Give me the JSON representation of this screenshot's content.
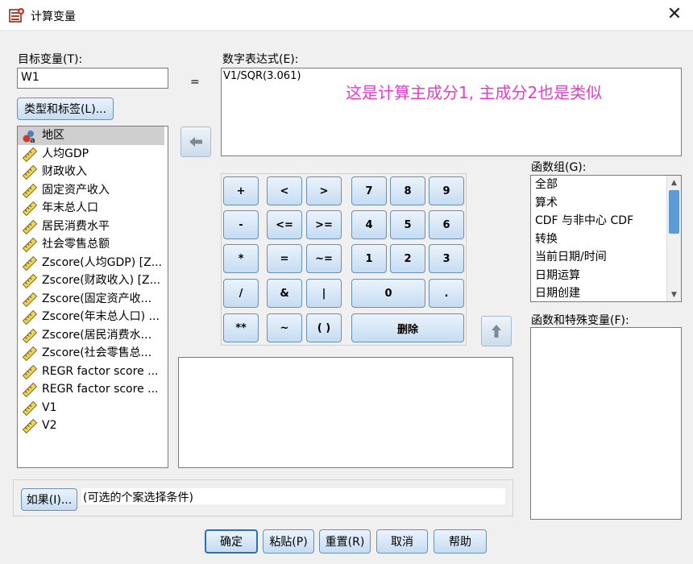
{
  "window": {
    "title": "计算变量",
    "close_glyph": "✕"
  },
  "target": {
    "label": "目标变量(T):",
    "value": "W1",
    "type_button": "类型和标签(L)..."
  },
  "equals": "=",
  "expression": {
    "label": "数字表达式(E):",
    "value": "V1/SQR(3.061)",
    "annotation": "这是计算主成分1, 主成分2也是类似",
    "annotation_color": "#e83ad2"
  },
  "variables": [
    {
      "name": "地区",
      "type": "nominal-string-icon"
    },
    {
      "name": "人均GDP",
      "type": "scale-ruler-icon"
    },
    {
      "name": "财政收入",
      "type": "scale-ruler-icon"
    },
    {
      "name": "固定资产收入",
      "type": "scale-ruler-icon"
    },
    {
      "name": "年末总人口",
      "type": "scale-ruler-icon"
    },
    {
      "name": "居民消费水平",
      "type": "scale-ruler-icon"
    },
    {
      "name": "社会零售总额",
      "type": "scale-ruler-icon"
    },
    {
      "name": "Zscore(人均GDP) [Z...",
      "type": "scale-ruler-icon"
    },
    {
      "name": "Zscore(财政收入) [Z...",
      "type": "scale-ruler-icon"
    },
    {
      "name": "Zscore(固定资产收...",
      "type": "scale-ruler-icon"
    },
    {
      "name": "Zscore(年末总人口) ...",
      "type": "scale-ruler-icon"
    },
    {
      "name": "Zscore(居民消费水...",
      "type": "scale-ruler-icon"
    },
    {
      "name": "Zscore(社会零售总...",
      "type": "scale-ruler-icon"
    },
    {
      "name": "REGR factor score  ...",
      "type": "scale-ruler-icon"
    },
    {
      "name": "REGR factor score  ...",
      "type": "scale-ruler-icon"
    },
    {
      "name": "V1",
      "type": "scale-ruler-icon"
    },
    {
      "name": "V2",
      "type": "scale-ruler-icon"
    }
  ],
  "keypad": {
    "ops": [
      [
        "+",
        "<",
        ">"
      ],
      [
        "-",
        "<=",
        ">="
      ],
      [
        "*",
        "=",
        "~="
      ],
      [
        "/",
        "&",
        "|"
      ],
      [
        "**",
        "~",
        "( )"
      ]
    ],
    "digits": [
      [
        "7",
        "8",
        "9"
      ],
      [
        "4",
        "5",
        "6"
      ],
      [
        "1",
        "2",
        "3"
      ]
    ],
    "zero": "0",
    "dot": ".",
    "delete": "删除"
  },
  "function_group": {
    "label": "函数组(G):",
    "items": [
      "全部",
      "算术",
      "CDF 与非中心 CDF",
      "转换",
      "当前日期/时间",
      "日期运算",
      "日期创建"
    ]
  },
  "functions_vars": {
    "label": "函数和特殊变量(F):"
  },
  "if_section": {
    "button": "如果(I)...",
    "text": "(可选的个案选择条件)"
  },
  "buttons": {
    "ok": "确定",
    "paste": "粘贴(P)",
    "reset": "重置(R)",
    "cancel": "取消",
    "help": "帮助"
  }
}
